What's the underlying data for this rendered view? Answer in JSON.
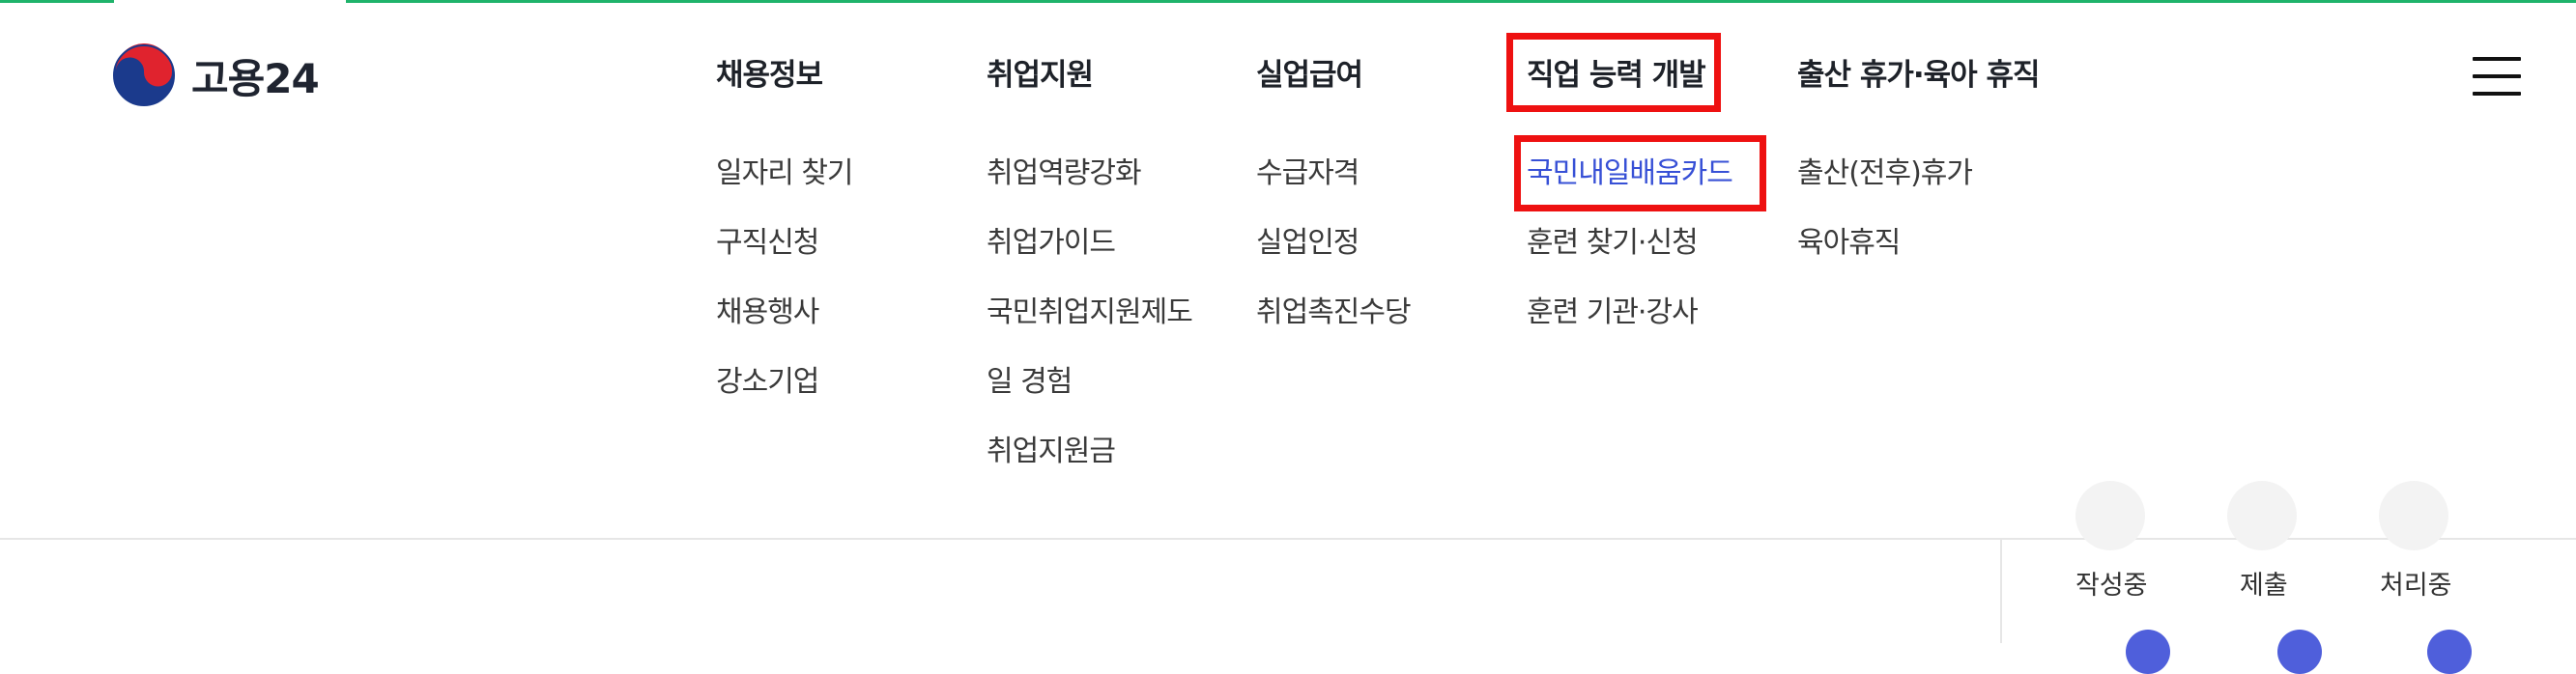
{
  "logo": {
    "text": "고용24"
  },
  "nav": [
    {
      "heading": "채용정보",
      "items": [
        "일자리 찾기",
        "구직신청",
        "채용행사",
        "강소기업"
      ]
    },
    {
      "heading": "취업지원",
      "items": [
        "취업역량강화",
        "취업가이드",
        "국민취업지원제도",
        "일 경험",
        "취업지원금"
      ]
    },
    {
      "heading": "실업급여",
      "items": [
        "수급자격",
        "실업인정",
        "취업촉진수당"
      ]
    },
    {
      "heading": "직업 능력 개발",
      "items": [
        "국민내일배움카드",
        "훈련 찾기·신청",
        "훈련 기관·강사"
      ]
    },
    {
      "heading": "출산 휴가·육아 휴직",
      "items": [
        "출산(전후)휴가",
        "육아휴직"
      ]
    }
  ],
  "status_steps": [
    "작성중",
    "제출",
    "처리중"
  ],
  "colors": {
    "accent": "#1fb36b",
    "active_link": "#3750d6",
    "highlight": "#ee1111",
    "step_dot": "#4f5fdb"
  },
  "icons": {
    "menu": "hamburger-menu-icon",
    "logo": "taegeuk-logo-icon"
  }
}
